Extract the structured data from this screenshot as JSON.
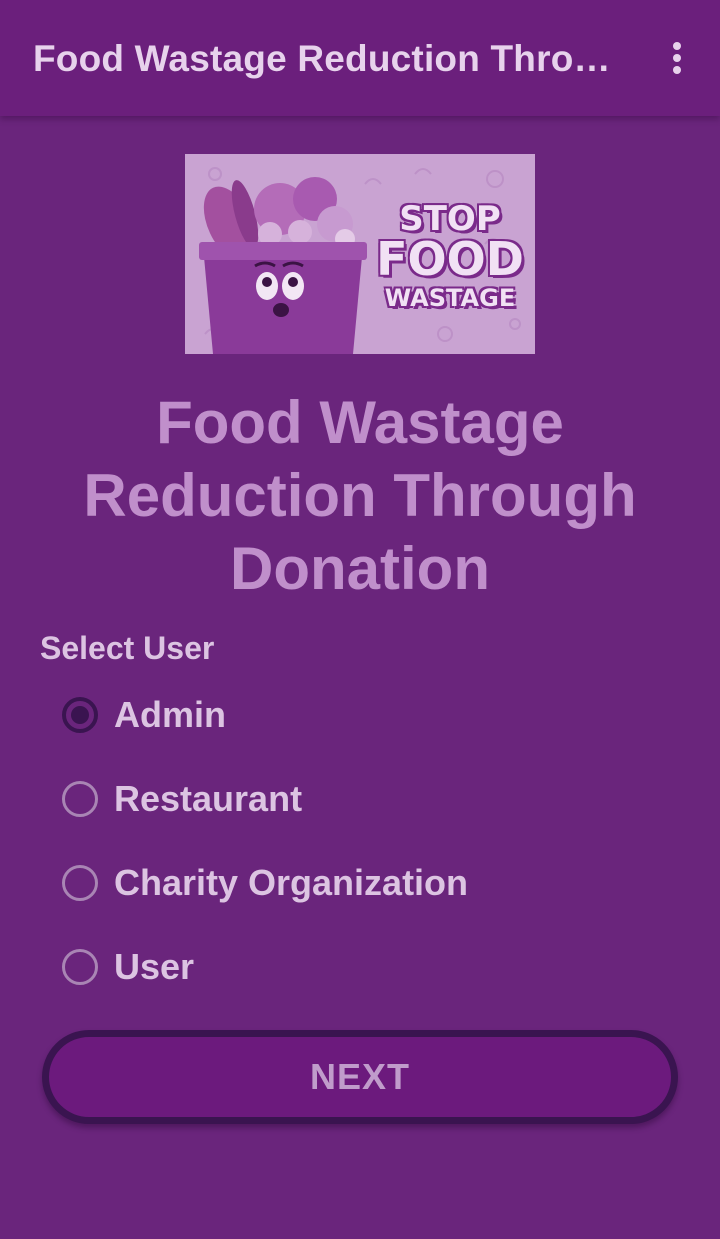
{
  "toolbar": {
    "title": "Food Wastage Reduction Throu…",
    "overflow_icon": "more-vert-icon"
  },
  "banner": {
    "line1": "STOP",
    "line2": "FOOD",
    "line3": "WASTAGE"
  },
  "main": {
    "title": "Food Wastage Reduction Through Donation",
    "select_label": "Select User",
    "options": [
      {
        "label": "Admin",
        "checked": true
      },
      {
        "label": "Restaurant",
        "checked": false
      },
      {
        "label": "Charity Organization",
        "checked": false
      },
      {
        "label": "User",
        "checked": false
      }
    ],
    "next_label": "NEXT"
  },
  "colors": {
    "background": "#6a257c",
    "toolbar": "#6b1f7c",
    "title_text": "#c08fcb",
    "radio_checked": "#3a1450",
    "button_border": "#3a1450"
  }
}
